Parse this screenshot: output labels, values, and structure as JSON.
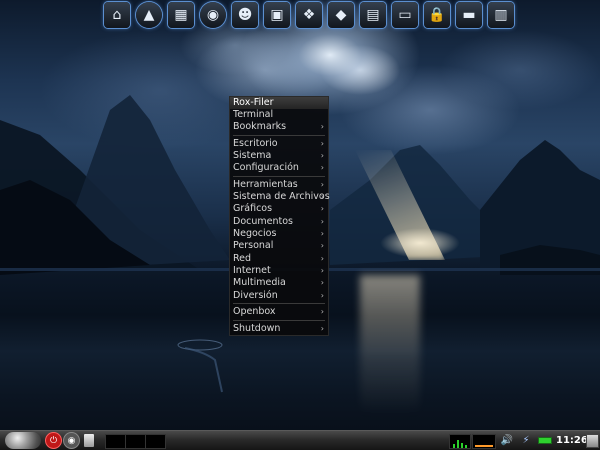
{
  "dock": {
    "icons": [
      {
        "name": "home-icon",
        "glyph": "⌂"
      },
      {
        "name": "arch-logo-icon",
        "glyph": "▲"
      },
      {
        "name": "calculator-icon",
        "glyph": "▦"
      },
      {
        "name": "browser-globe-icon",
        "glyph": "◉"
      },
      {
        "name": "users-icon",
        "glyph": "☻"
      },
      {
        "name": "video-clapper-icon",
        "glyph": "▣"
      },
      {
        "name": "package-manager-icon",
        "glyph": "❖"
      },
      {
        "name": "image-viewer-icon",
        "glyph": "◆"
      },
      {
        "name": "text-editor-icon",
        "glyph": "▤"
      },
      {
        "name": "terminal-icon",
        "glyph": "▭"
      },
      {
        "name": "lock-icon",
        "glyph": "🔒"
      },
      {
        "name": "disk-drive-icon",
        "glyph": "▬"
      },
      {
        "name": "trash-icon",
        "glyph": "▥"
      }
    ]
  },
  "menu": {
    "title": "Rox-Filer",
    "items": [
      {
        "label": "Terminal",
        "submenu": false
      },
      {
        "label": "Bookmarks",
        "submenu": true
      },
      {
        "separator": true
      },
      {
        "label": "Escritorio",
        "submenu": true
      },
      {
        "label": "Sistema",
        "submenu": true
      },
      {
        "label": "Configuración",
        "submenu": true
      },
      {
        "separator": true
      },
      {
        "label": "Herramientas",
        "submenu": true
      },
      {
        "label": "Sistema de Archivos",
        "submenu": true
      },
      {
        "label": "Gráficos",
        "submenu": true
      },
      {
        "label": "Documentos",
        "submenu": true
      },
      {
        "label": "Negocios",
        "submenu": true
      },
      {
        "label": "Personal",
        "submenu": true
      },
      {
        "label": "Red",
        "submenu": true
      },
      {
        "label": "Internet",
        "submenu": true
      },
      {
        "label": "Multimedia",
        "submenu": true
      },
      {
        "label": "Diversión",
        "submenu": true
      },
      {
        "separator": true
      },
      {
        "label": "Openbox",
        "submenu": true
      },
      {
        "separator": true
      },
      {
        "label": "Shutdown",
        "submenu": true
      }
    ],
    "arrow_glyph": "›"
  },
  "taskbar": {
    "clock": "11:26",
    "power_glyph": "⏻",
    "camera_glyph": "◉",
    "volume_glyph": "🔊",
    "network_glyph": "⚡",
    "accent_colors": {
      "cpu_graph": "#2bd12b",
      "net_graph": "#ff9a2a",
      "power_button": "#c01818"
    }
  }
}
